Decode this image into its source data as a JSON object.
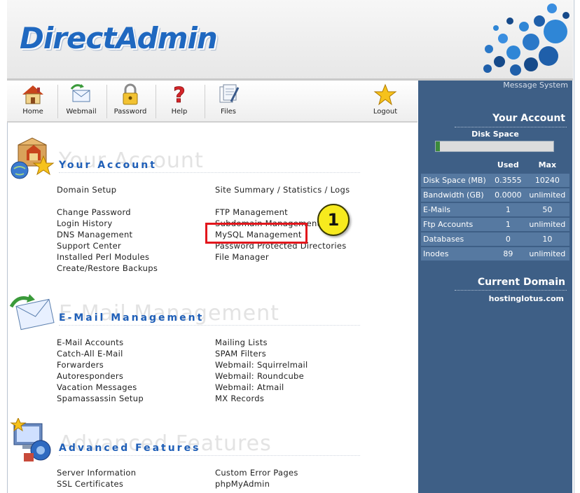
{
  "header": {
    "logo": "DirectAdmin"
  },
  "toolbar": [
    {
      "label": "Home",
      "icon": "home-icon"
    },
    {
      "label": "Webmail",
      "icon": "webmail-icon"
    },
    {
      "label": "Password",
      "icon": "lock-icon"
    },
    {
      "label": "Help",
      "icon": "help-icon"
    },
    {
      "label": "Files",
      "icon": "files-icon"
    },
    {
      "label": "Logout",
      "icon": "star-icon"
    }
  ],
  "sidebar": {
    "message_system": "Message System",
    "your_account": "Your Account",
    "disk_space_label": "Disk Space",
    "disk_usage_fraction": 0.035,
    "col_used": "Used",
    "col_max": "Max",
    "stats": [
      {
        "label": "Disk Space (MB)",
        "used": "0.3555",
        "max": "10240"
      },
      {
        "label": "Bandwidth (GB)",
        "used": "0.0000",
        "max": "unlimited"
      },
      {
        "label": "E-Mails",
        "used": "1",
        "max": "50"
      },
      {
        "label": "Ftp Accounts",
        "used": "1",
        "max": "unlimited"
      },
      {
        "label": "Databases",
        "used": "0",
        "max": "10"
      },
      {
        "label": "Inodes",
        "used": "89",
        "max": "unlimited"
      }
    ],
    "current_domain_title": "Current Domain",
    "domain": "hostinglotus.com"
  },
  "sections": {
    "account": {
      "title": "Your Account",
      "left": [
        "Domain Setup",
        "Change Password",
        "Login History",
        "DNS Management",
        "Support Center",
        "Installed Perl Modules",
        "Create/Restore Backups"
      ],
      "right": [
        "Site Summary / Statistics / Logs",
        "FTP Management",
        "Subdomain Management",
        "MySQL Management",
        "Password Protected Directories",
        "File Manager"
      ]
    },
    "email": {
      "title": "E-Mail Management",
      "left": [
        "E-Mail Accounts",
        "Catch-All E-Mail",
        "Forwarders",
        "Autoresponders",
        "Vacation Messages",
        "Spamassassin Setup"
      ],
      "right": [
        "Mailing Lists",
        "SPAM Filters",
        "Webmail: Squirrelmail",
        "Webmail: Roundcube",
        "Webmail: Atmail",
        "MX Records"
      ]
    },
    "advanced": {
      "title": "Advanced Features",
      "left": [
        "Server Information",
        "SSL Certificates"
      ],
      "right": [
        "Custom Error Pages",
        "phpMyAdmin"
      ]
    }
  },
  "callout": {
    "number": "1"
  },
  "colors": {
    "accent": "#1f5fb8",
    "sidebar": "#3e5f86",
    "highlight": "#e2161c",
    "callout": "#f7ea1e"
  }
}
